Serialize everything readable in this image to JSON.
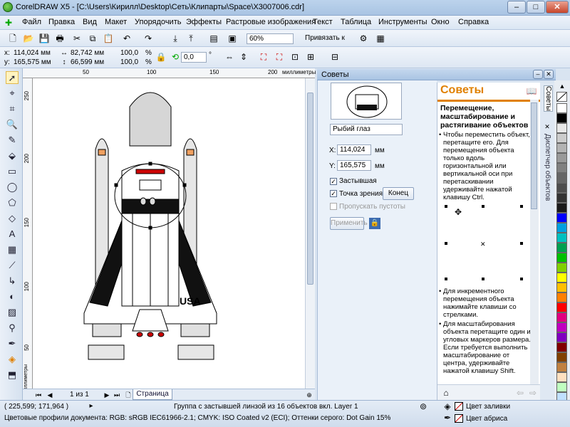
{
  "window": {
    "title": "CorelDRAW X5 - [C:\\Users\\Кирилл\\Desktop\\Сеть\\Клипарты\\Space\\X3007006.cdr]",
    "min": "–",
    "max": "□",
    "close": "✕"
  },
  "menu": [
    "Файл",
    "Правка",
    "Вид",
    "Макет",
    "Упорядочить",
    "Эффекты",
    "Растровые изображения",
    "Текст",
    "Таблица",
    "Инструменты",
    "Окно",
    "Справка"
  ],
  "std_toolbar": {
    "zoom": "60%",
    "snap": "Привязать к"
  },
  "property_bar": {
    "x": "114,024 мм",
    "y": "165,575 мм",
    "w": "82,742 мм",
    "h": "66,599 мм",
    "sx": "100,0",
    "sy": "100,0",
    "pct": "%",
    "angle": "0,0",
    "deg": "°"
  },
  "rulers": {
    "unit": "миллиметры",
    "top_ticks": [
      "50",
      "100",
      "150",
      "200"
    ],
    "left_ticks": [
      "250",
      "200",
      "150",
      "100",
      "50"
    ],
    "left_unit": "миллиметры"
  },
  "canvas": {
    "usa": "USA"
  },
  "page_nav": {
    "pages": "1 из 1",
    "tab": "Страница"
  },
  "status": {
    "coords": "( 225,599; 171,964 )",
    "info": "Группа с застывшей линзой из 16 объектов вкл. Layer 1",
    "profiles": "Цветовые профили документа: RGB: sRGB IEC61966-2.1; CMYK: ISO Coated v2 (ECI); Оттенки серого: Dot Gain 15%",
    "fill": "Цвет заливки",
    "outline": "Цвет абриса"
  },
  "docker_title": "Советы",
  "lens": {
    "type": "Рыбий глаз",
    "x_label": "X:",
    "x": "114,024",
    "y_label": "Y:",
    "y": "165,575",
    "unit": "мм",
    "frozen": "Застывшая",
    "viewpoint": "Точка зрения",
    "end": "Конец",
    "skip": "Пропускать пустоты",
    "apply": "Применить"
  },
  "tips": {
    "heading": "Советы",
    "subheading": "Перемещение, масштабирование и растягивание объектов",
    "p1": "Чтобы переместить объект, перетащите его. Для перемещения объекта только вдоль горизонтальной или вертикальной оси при перетаскивании удерживайте нажатой клавишу Ctrl.",
    "p2": "Для инкрементного перемещения объекта нажимайте клавиши со стрелками.",
    "p3": "Для масштабирования объекта перетащите один из угловых маркеров размера. Если требуется выполнить масштабирование от центра, удерживайте нажатой клавишу Shift."
  },
  "vtabs": [
    "Советы",
    "Диспетчер объектов"
  ],
  "palette": [
    "#ffffff",
    "#000000",
    "#e8e8e8",
    "#cccccc",
    "#b3b3b3",
    "#999999",
    "#808080",
    "#666666",
    "#4d4d4d",
    "#333333",
    "#1a1a1a",
    "#0000ff",
    "#00a0e0",
    "#00c0c0",
    "#00a050",
    "#00c000",
    "#80d000",
    "#ffff00",
    "#ffc000",
    "#ff8000",
    "#ff0000",
    "#e00080",
    "#c000c0",
    "#8000c0",
    "#800000",
    "#804000",
    "#c08040",
    "#ffe0c0",
    "#c0ffc0",
    "#c0e0ff"
  ]
}
